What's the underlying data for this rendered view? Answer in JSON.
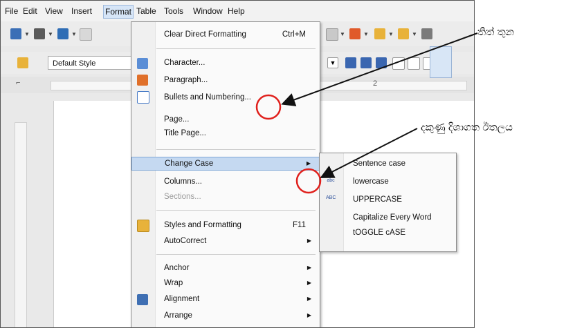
{
  "menubar": {
    "items": [
      "File",
      "Edit",
      "View",
      "Insert",
      "Format",
      "Table",
      "Tools",
      "Window",
      "Help"
    ]
  },
  "formatting_toolbar": {
    "paragraph_style": "Default Style"
  },
  "ruler": {
    "mark": "2"
  },
  "format_menu": {
    "items": [
      {
        "label": "Clear Direct Formatting",
        "shortcut": "Ctrl+M"
      },
      {
        "label": "Character..."
      },
      {
        "label": "Paragraph..."
      },
      {
        "label": "Bullets and Numbering..."
      },
      {
        "label": "Page..."
      },
      {
        "label": "Title Page..."
      },
      {
        "label": "Change Case"
      },
      {
        "label": "Columns..."
      },
      {
        "label": "Sections..."
      },
      {
        "label": "Styles and Formatting",
        "shortcut": "F11"
      },
      {
        "label": "AutoCorrect"
      },
      {
        "label": "Anchor"
      },
      {
        "label": "Wrap"
      },
      {
        "label": "Alignment"
      },
      {
        "label": "Arrange"
      }
    ]
  },
  "change_case_submenu": {
    "items": [
      "Sentence case",
      "lowercase",
      "UPPERCASE",
      "Capitalize Every Word",
      "tOGGLE cASE"
    ]
  },
  "annotations": {
    "dots": "තිත් තුන",
    "right_arrow": "දකුණු දිශාගත ඊතලය"
  },
  "colors": {
    "highlight": "#c5d9f1",
    "callout_circle": "#e0201c"
  }
}
